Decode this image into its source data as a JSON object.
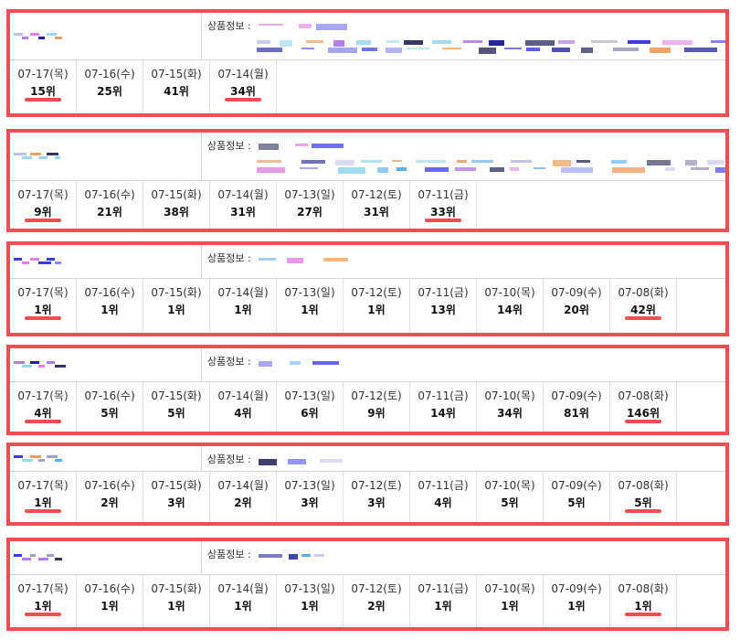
{
  "info_label": "상품정보 :",
  "colors": {
    "card_border": "#ee4e54",
    "underline": "#ee4e54"
  },
  "cards": [
    {
      "days": [
        {
          "date": "07-17(목)",
          "rank": "15위",
          "underline": true
        },
        {
          "date": "07-16(수)",
          "rank": "25위"
        },
        {
          "date": "07-15(화)",
          "rank": "41위"
        },
        {
          "date": "07-14(월)",
          "rank": "34위",
          "underline": true
        }
      ]
    },
    {
      "days": [
        {
          "date": "07-17(목)",
          "rank": "9위",
          "underline": true
        },
        {
          "date": "07-16(수)",
          "rank": "21위"
        },
        {
          "date": "07-15(화)",
          "rank": "38위"
        },
        {
          "date": "07-14(월)",
          "rank": "31위"
        },
        {
          "date": "07-13(일)",
          "rank": "27위"
        },
        {
          "date": "07-12(토)",
          "rank": "31위"
        },
        {
          "date": "07-11(금)",
          "rank": "33위",
          "underline": true
        }
      ]
    },
    {
      "days": [
        {
          "date": "07-17(목)",
          "rank": "1위",
          "underline": true
        },
        {
          "date": "07-16(수)",
          "rank": "1위"
        },
        {
          "date": "07-15(화)",
          "rank": "1위"
        },
        {
          "date": "07-14(월)",
          "rank": "1위"
        },
        {
          "date": "07-13(일)",
          "rank": "1위"
        },
        {
          "date": "07-12(토)",
          "rank": "1위"
        },
        {
          "date": "07-11(금)",
          "rank": "13위"
        },
        {
          "date": "07-10(목)",
          "rank": "14위"
        },
        {
          "date": "07-09(수)",
          "rank": "20위"
        },
        {
          "date": "07-08(화)",
          "rank": "42위",
          "underline": true
        }
      ]
    },
    {
      "days": [
        {
          "date": "07-17(목)",
          "rank": "4위",
          "underline": true
        },
        {
          "date": "07-16(수)",
          "rank": "5위"
        },
        {
          "date": "07-15(화)",
          "rank": "5위"
        },
        {
          "date": "07-14(월)",
          "rank": "4위"
        },
        {
          "date": "07-13(일)",
          "rank": "6위"
        },
        {
          "date": "07-12(토)",
          "rank": "9위"
        },
        {
          "date": "07-11(금)",
          "rank": "14위"
        },
        {
          "date": "07-10(목)",
          "rank": "34위"
        },
        {
          "date": "07-09(수)",
          "rank": "81위"
        },
        {
          "date": "07-08(화)",
          "rank": "146위",
          "underline": true
        }
      ]
    },
    {
      "days": [
        {
          "date": "07-17(목)",
          "rank": "1위",
          "underline": true
        },
        {
          "date": "07-16(수)",
          "rank": "2위"
        },
        {
          "date": "07-15(화)",
          "rank": "3위"
        },
        {
          "date": "07-14(월)",
          "rank": "2위"
        },
        {
          "date": "07-13(일)",
          "rank": "3위"
        },
        {
          "date": "07-12(토)",
          "rank": "3위"
        },
        {
          "date": "07-11(금)",
          "rank": "4위"
        },
        {
          "date": "07-10(목)",
          "rank": "5위"
        },
        {
          "date": "07-09(수)",
          "rank": "5위"
        },
        {
          "date": "07-08(화)",
          "rank": "5위",
          "underline": true
        }
      ]
    },
    {
      "days": [
        {
          "date": "07-17(목)",
          "rank": "1위",
          "underline": true
        },
        {
          "date": "07-16(수)",
          "rank": "1위"
        },
        {
          "date": "07-15(화)",
          "rank": "1위"
        },
        {
          "date": "07-14(월)",
          "rank": "1위"
        },
        {
          "date": "07-13(일)",
          "rank": "1위"
        },
        {
          "date": "07-12(토)",
          "rank": "2위"
        },
        {
          "date": "07-11(금)",
          "rank": "1위"
        },
        {
          "date": "07-10(목)",
          "rank": "1위"
        },
        {
          "date": "07-09(수)",
          "rank": "1위"
        },
        {
          "date": "07-08(화)",
          "rank": "1위",
          "underline": true
        }
      ]
    }
  ]
}
